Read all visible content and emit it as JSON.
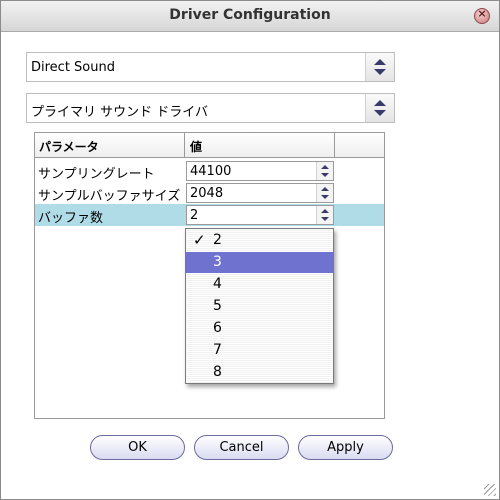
{
  "window": {
    "title": "Driver Configuration"
  },
  "driver_select": {
    "value": "Direct Sound"
  },
  "device_select": {
    "value": "プライマリ サウンド ドライバ"
  },
  "table": {
    "headers": [
      "パラメータ",
      "値"
    ],
    "rows": [
      {
        "label": "サンプリングレート",
        "value": "44100"
      },
      {
        "label": "サンプルバッファサイズ",
        "value": "2048"
      },
      {
        "label": "バッファ数",
        "value": "2"
      }
    ],
    "selected_row": 2
  },
  "dropdown": {
    "options": [
      "2",
      "3",
      "4",
      "5",
      "6",
      "7",
      "8"
    ],
    "checked": "2",
    "highlighted": "3",
    "check_glyph": "✓"
  },
  "buttons": {
    "ok": "OK",
    "cancel": "Cancel",
    "apply": "Apply"
  },
  "colors": {
    "selection_row": "#b0dce8",
    "menu_highlight": "#6f73cf"
  },
  "icons": {
    "close": "close-icon",
    "combo_arrows": "up-down-arrows-icon"
  }
}
